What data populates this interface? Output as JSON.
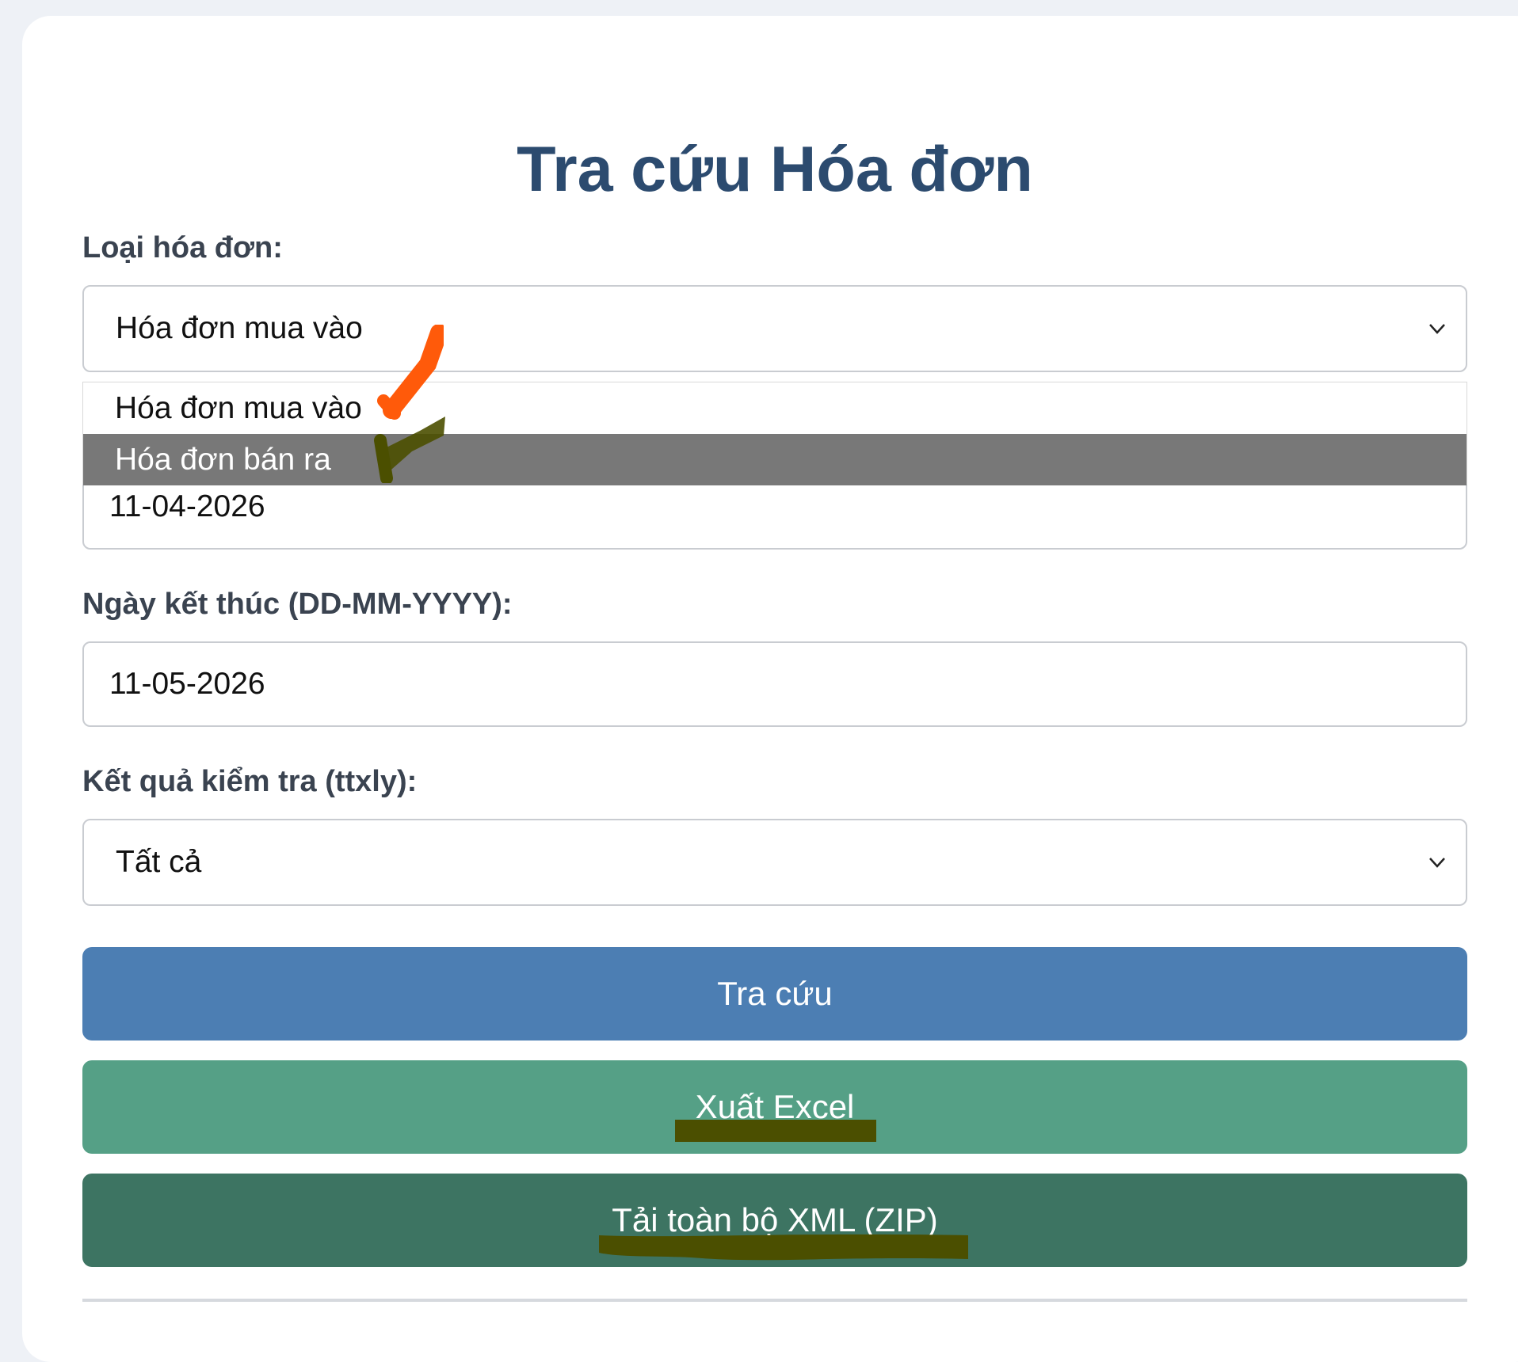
{
  "title": "Tra cứu Hóa đơn",
  "invoice_type": {
    "label": "Loại hóa đơn:",
    "selected": "Hóa đơn mua vào",
    "options": [
      "Hóa đơn mua vào",
      "Hóa đơn bán ra"
    ]
  },
  "start_date": {
    "value": "11-04-2026"
  },
  "end_date": {
    "label": "Ngày kết thúc (DD-MM-YYYY):",
    "value": "11-05-2026"
  },
  "check_result": {
    "label": "Kết quả kiểm tra (ttxly):",
    "selected": "Tất cả"
  },
  "buttons": {
    "search": "Tra cứu",
    "export_excel": "Xuất Excel",
    "download_zip": "Tải toàn bộ XML (ZIP)"
  },
  "colors": {
    "title": "#2c4b6f",
    "search_button": "#4c7eb3",
    "excel_button": "#55a086",
    "zip_button": "#3d7462",
    "annotation_orange": "#ff5a0a",
    "annotation_olive": "#4b4f00"
  }
}
